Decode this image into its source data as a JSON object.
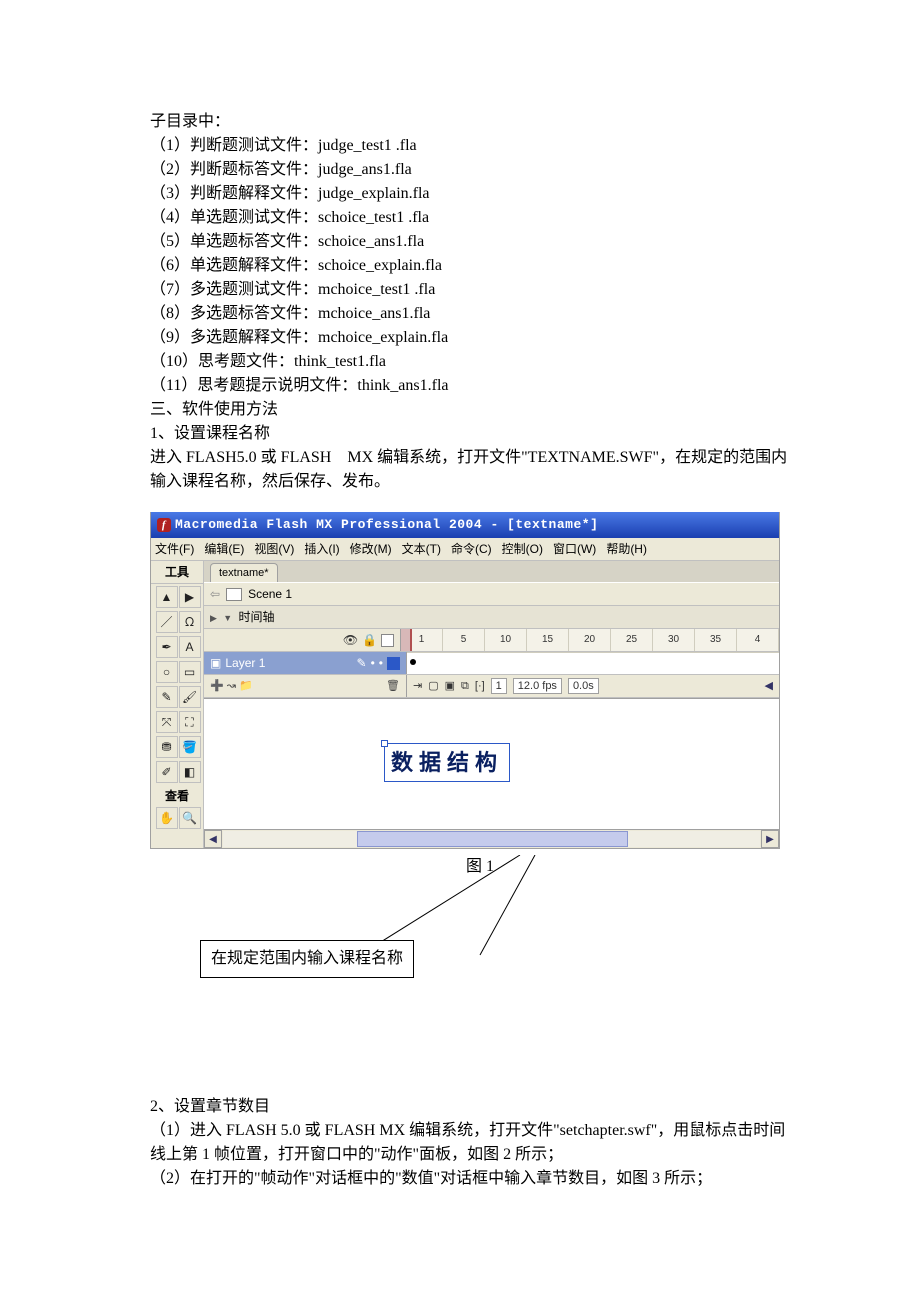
{
  "doc": {
    "intro": "子目录中：",
    "files": [
      "（1）判断题测试文件：judge_test1 .fla",
      "（2）判断题标答文件：judge_ans1.fla",
      "（3）判断题解释文件：judge_explain.fla",
      "（4）单选题测试文件：schoice_test1 .fla",
      "（5）单选题标答文件：schoice_ans1.fla",
      "（6）单选题解释文件：schoice_explain.fla",
      "（7）多选题测试文件：mchoice_test1 .fla",
      "（8）多选题标答文件：mchoice_ans1.fla",
      "（9）多选题解释文件：mchoice_explain.fla",
      "（10）思考题文件：think_test1.fla",
      "（11）思考题提示说明文件：think_ans1.fla"
    ],
    "section3": "三、软件使用方法",
    "step1_title": "1、设置课程名称",
    "step1_body": "进入 FLASH5.0 或 FLASH　MX 编辑系统，打开文件\"TEXTNAME.SWF\"，在规定的范围内输入课程名称，然后保存、发布。",
    "fig1_label": "图 1",
    "callout": "在规定范围内输入课程名称",
    "step2_title": "2、设置章节数目",
    "step2_line1": "（1）进入 FLASH 5.0  或 FLASH MX 编辑系统，打开文件\"setchapter.swf\"，用鼠标点击时间线上第 1 帧位置，打开窗口中的\"动作\"面板，如图 2 所示；",
    "step2_line2": "（2）在打开的\"帧动作\"对话框中的\"数值\"对话框中输入章节数目，如图 3 所示；"
  },
  "app": {
    "title": "Macromedia Flash MX Professional 2004 - [textname*]",
    "menus": [
      "文件(F)",
      "编辑(E)",
      "视图(V)",
      "插入(I)",
      "修改(M)",
      "文本(T)",
      "命令(C)",
      "控制(O)",
      "窗口(W)",
      "帮助(H)"
    ],
    "tools_title": "工具",
    "view_title": "查看",
    "tab": "textname*",
    "scene": "Scene 1",
    "timeline_title": "时间轴",
    "layer": "Layer 1",
    "ruler_marks": [
      "1",
      "5",
      "10",
      "15",
      "20",
      "25",
      "30",
      "35",
      "4"
    ],
    "frame_num": "1",
    "fps": "12.0 fps",
    "time": "0.0s",
    "stage_text": "数据结构"
  }
}
